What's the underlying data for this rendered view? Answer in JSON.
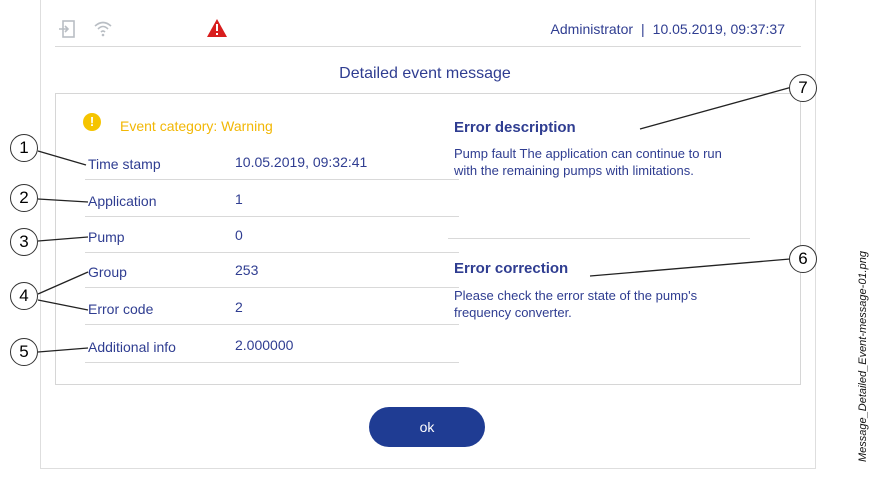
{
  "header": {
    "user": "Administrator",
    "separator": "|",
    "datetime": "10.05.2019, 09:37:37",
    "icons": [
      "login-icon",
      "wifi-icon",
      "alarm-warning-icon"
    ]
  },
  "dialog": {
    "title": "Detailed event message",
    "event_category": "Event category:  Warning",
    "rows": [
      {
        "label": "Time stamp",
        "value": "10.05.2019, 09:32:41"
      },
      {
        "label": "Application",
        "value": "1"
      },
      {
        "label": "Pump",
        "value": "0"
      },
      {
        "label": "Group",
        "value": "253"
      },
      {
        "label": "Error code",
        "value": "2"
      },
      {
        "label": "Additional info",
        "value": "2.000000"
      }
    ],
    "error_description": {
      "heading": "Error description",
      "text": "Pump fault The application can continue to run with the remaining pumps with limitations."
    },
    "error_correction": {
      "heading": "Error correction",
      "text": "Please check the error state of the pump's frequency converter."
    },
    "ok_label": "ok"
  },
  "callouts": [
    "1",
    "2",
    "3",
    "4",
    "5",
    "6",
    "7"
  ],
  "filename": "Message_Detailed_Event-message-01.png",
  "colors": {
    "text": "#2f3d91",
    "warning": "#f2b705",
    "alarm": "#d81e1e",
    "button": "#1f3c93"
  }
}
